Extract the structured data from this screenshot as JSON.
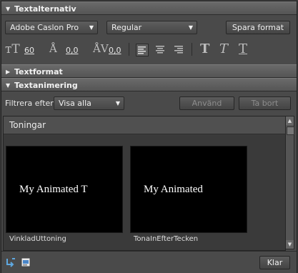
{
  "sections": {
    "textalternativ": "Textalternativ",
    "textformat": "Textformat",
    "textanimering": "Textanimering"
  },
  "font": {
    "family": "Adobe Caslon Pro",
    "style": "Regular",
    "align": "",
    "save_preset": "Spara format"
  },
  "metrics": {
    "size": "60",
    "leading": "0,0",
    "tracking": "0,0"
  },
  "animation": {
    "filter_label": "Filtrera efter:",
    "filter_value": "Visa alla",
    "apply": "Använd",
    "remove": "Ta bort"
  },
  "gallery": {
    "title": "Toningar",
    "items": [
      {
        "preview": "My Animated T",
        "caption": "VinkladUttoning"
      },
      {
        "preview": "My Animated",
        "caption": "TonaInEfterTecken"
      }
    ]
  },
  "footer": {
    "done": "Klar"
  },
  "icons": {
    "size": "font-size-icon",
    "leading": "leading-icon",
    "tracking": "tracking-icon"
  }
}
